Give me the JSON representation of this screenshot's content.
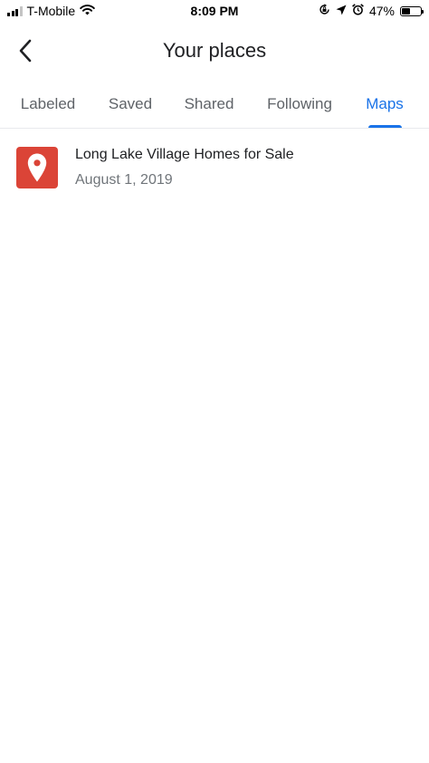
{
  "status_bar": {
    "carrier": "T-Mobile",
    "time": "8:09 PM",
    "battery_percent": "47%",
    "battery_level": 0.47,
    "signal_bars": 3,
    "icons": [
      "wifi-icon",
      "screen-lock-rotation-icon",
      "location-arrow-icon",
      "alarm-icon"
    ]
  },
  "header": {
    "title": "Your places",
    "back_icon": "chevron-left-icon"
  },
  "tabs": [
    {
      "label": "Labeled",
      "active": false
    },
    {
      "label": "Saved",
      "active": false
    },
    {
      "label": "Shared",
      "active": false
    },
    {
      "label": "Following",
      "active": false
    },
    {
      "label": "Maps",
      "active": true
    }
  ],
  "colors": {
    "accent": "#1a73e8",
    "map_thumb": "#db4437",
    "text_primary": "#202124",
    "text_secondary": "#70757a",
    "tab_inactive": "#5f6368"
  },
  "maps": [
    {
      "title": "Long Lake Village Homes for Sale",
      "date": "August 1, 2019",
      "icon": "map-pin-icon"
    }
  ]
}
